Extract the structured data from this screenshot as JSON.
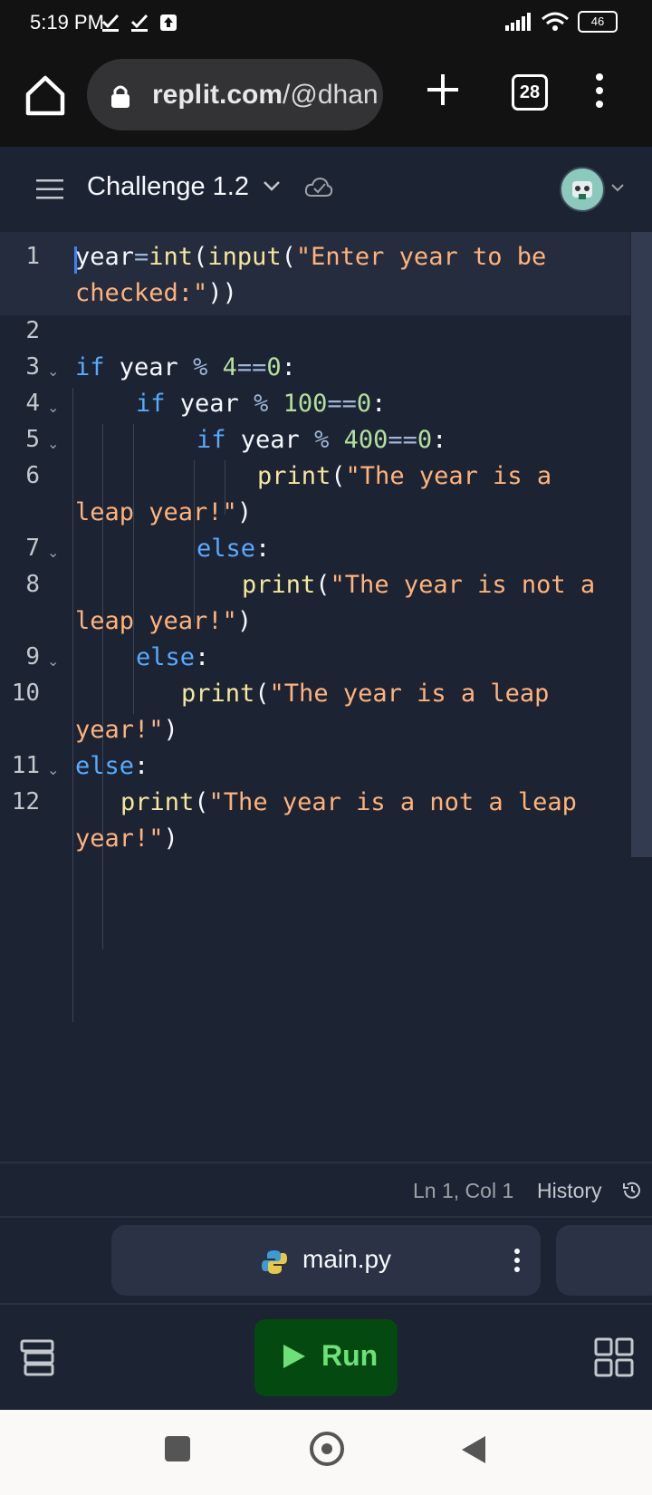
{
  "status_bar": {
    "time": "5:19 PM",
    "battery": "46"
  },
  "browser": {
    "url_host": "rep",
    "url_host2": "it.com",
    "url_path": "/@dhan",
    "tab_count": "28"
  },
  "header": {
    "title": "Challenge 1.2"
  },
  "editor": {
    "line_numbers": [
      "1",
      "2",
      "3",
      "4",
      "5",
      "6",
      "7",
      "8",
      "9",
      "10",
      "11",
      "12"
    ],
    "code": {
      "l1a": "year",
      "l1b": "=",
      "l1c": "int",
      "l1d": "(",
      "l1e": "input",
      "l1f": "(",
      "l1g": "\"Enter year to be",
      "l1h": "checked:\"",
      "l1i": "))",
      "l3_if": "if",
      "l3_var": " year ",
      "l3_op": "%",
      "l3_num": " 4",
      "l3_op2": "==",
      "l3_num2": "0",
      "l3_end": ":",
      "l4_if": "if",
      "l4_var": " year ",
      "l4_op": "%",
      "l4_num": " 100",
      "l4_op2": "==",
      "l4_num2": "0",
      "l4_end": ":",
      "l5_if": "if",
      "l5_var": " year ",
      "l5_op": "%",
      "l5_num": " 400",
      "l5_op2": "==",
      "l5_num2": "0",
      "l5_end": ":",
      "l6_fn": "print",
      "l6_p": "(",
      "l6_str": "\"The year is a",
      "l6_str2": "leap year!\"",
      "l6_p2": ")",
      "l7_else": "else",
      "l7_end": ":",
      "l8_fn": "print",
      "l8_p": "(",
      "l8_str": "\"The year is not a",
      "l8_str2": "leap year!\"",
      "l8_p2": ")",
      "l9_else": "else",
      "l9_end": ":",
      "l10_fn": "print",
      "l10_p": "(",
      "l10_str": "\"The year is a leap",
      "l10_str2": "year!\"",
      "l10_p2": ")",
      "l11_else": "else",
      "l11_end": ":",
      "l12_fn": "print",
      "l12_p": "(",
      "l12_str": "\"The year is a not a leap",
      "l12_str2": "year!\"",
      "l12_p2": ")"
    }
  },
  "editor_footer": {
    "cursor_position": "Ln 1, Col 1",
    "history_label": "History"
  },
  "file_tab": {
    "name": "main.py"
  },
  "toolbar": {
    "run_label": "Run"
  }
}
